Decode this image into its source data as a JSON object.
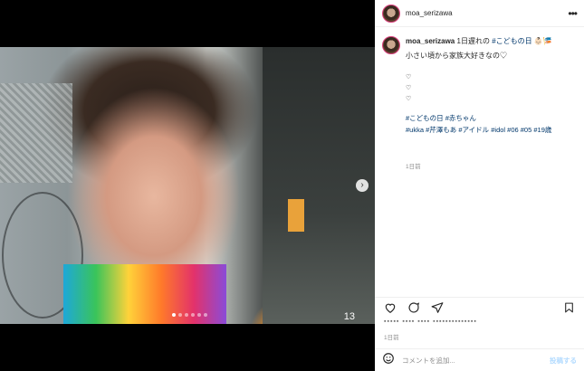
{
  "post": {
    "username": "moa_serizawa",
    "caption_user": "moa_serizawa",
    "caption_text": "1日遅れの",
    "caption_tag": "#こどもの日",
    "caption_emoji": "👶🏻🎏",
    "body_line": "小さい頃から家族大好きなの♡",
    "hearts": [
      "♡",
      "♡",
      "♡"
    ],
    "hashtags_line1": "#こどもの日 #赤ちゃん",
    "hashtags_line2": "#ukka #芹澤もあ #アイドル #idol #06 #05 #19歳",
    "caption_time": "1日前",
    "likes_text": "▪▪▪▪▪ ▪▪▪▪ ▪▪▪▪ ▪▪▪▪▪▪▪▪▪▪▪▪▪▪",
    "posted_ago": "1日前",
    "image_counter": "13",
    "comment_placeholder": "コメントを追加...",
    "post_button": "投稿する",
    "more_label": "•••"
  },
  "carousel": {
    "total": 6,
    "active_index": 0
  },
  "icons": {
    "like": "heart-icon",
    "comment": "comment-icon",
    "share": "send-icon",
    "save": "bookmark-icon",
    "emoji": "smiley-icon",
    "next": "chevron-right-icon"
  },
  "colors": {
    "link": "#00376b",
    "muted": "#8e8e8e",
    "text": "#262626",
    "border": "#efefef",
    "post_btn": "#b3dbff"
  }
}
